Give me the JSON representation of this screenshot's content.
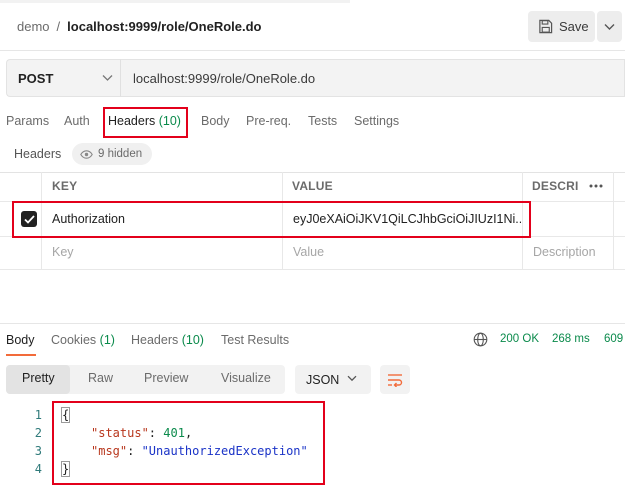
{
  "header": {
    "breadcrumb_workspace": "demo",
    "breadcrumb_separator": "/",
    "breadcrumb_request": "localhost:9999/role/OneRole.do",
    "save_label": "Save"
  },
  "request": {
    "method": "POST",
    "url": "localhost:9999/role/OneRole.do"
  },
  "request_tabs": {
    "params": "Params",
    "auth": "Auth",
    "headers": "Headers",
    "headers_count": "(10)",
    "body": "Body",
    "prereq": "Pre-req.",
    "tests": "Tests",
    "settings": "Settings"
  },
  "headers_section": {
    "label": "Headers",
    "hidden_badge": "9 hidden"
  },
  "table": {
    "col_key": "KEY",
    "col_value": "VALUE",
    "col_description": "DESCRI",
    "rows": [
      {
        "checked": true,
        "key": "Authorization",
        "value": "eyJ0eXAiOiJKV1QiLCJhbGciOiJIUzI1Ni..."
      }
    ],
    "placeholder_key": "Key",
    "placeholder_value": "Value",
    "placeholder_description": "Description"
  },
  "response_tabs": {
    "body": "Body",
    "cookies": "Cookies",
    "cookies_count": "(1)",
    "headers": "Headers",
    "headers_count": "(10)",
    "test_results": "Test Results"
  },
  "response_status": {
    "status": "200 OK",
    "time": "268 ms",
    "size": "609"
  },
  "view_modes": {
    "pretty": "Pretty",
    "raw": "Raw",
    "preview": "Preview",
    "visualize": "Visualize",
    "format": "JSON"
  },
  "response_body": {
    "line_numbers": [
      "1",
      "2",
      "3",
      "4"
    ],
    "open_brace": "{",
    "close_brace": "}",
    "status_key": "\"status\"",
    "status_value": "401",
    "msg_key": "\"msg\"",
    "msg_value": "\"UnauthorizedException\""
  },
  "colors": {
    "highlight": "#e3001b",
    "success": "#0a8a4b",
    "active_underline": "#f26b3a"
  },
  "icons": [
    "save-icon",
    "chevron-down-icon",
    "eye-icon",
    "more-horizontal-icon",
    "check-icon",
    "globe-icon",
    "wrap-lines-icon"
  ]
}
